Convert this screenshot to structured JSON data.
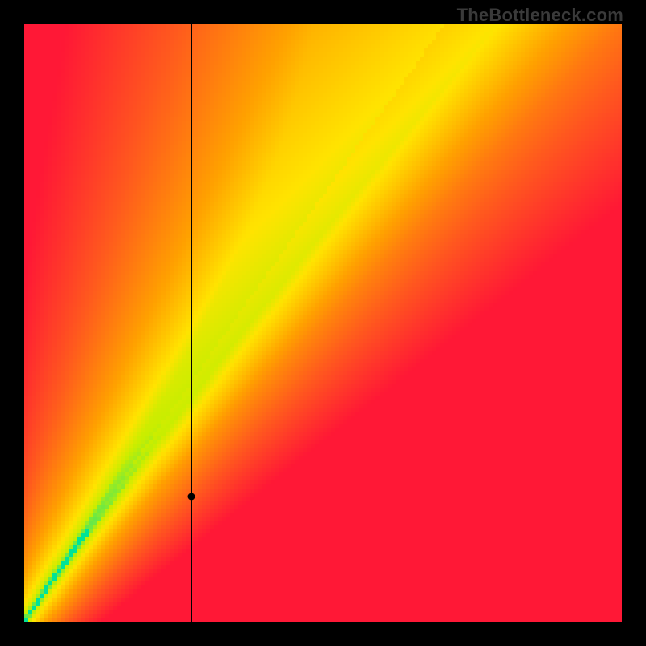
{
  "watermark": "TheBottleneck.com",
  "chart_data": {
    "type": "heatmap",
    "title": "",
    "xlabel": "",
    "ylabel": "",
    "xlim": [
      0,
      100
    ],
    "ylim": [
      0,
      100
    ],
    "grid": false,
    "legend": false,
    "crosshair": {
      "x": 28,
      "y": 21
    },
    "marker": {
      "x": 28,
      "y": 21
    },
    "optimal_band": {
      "description": "Diagonal green band indicating balanced pairing; slope steeper than 1 in lower third, then straightening toward upper-right.",
      "slope_low": 0.78,
      "slope_high": 1.55,
      "band_half_width_fraction": 0.035
    },
    "color_stops": [
      {
        "ratio_distance": 0.0,
        "color": "#00e397"
      },
      {
        "ratio_distance": 0.07,
        "color": "#c8ee00"
      },
      {
        "ratio_distance": 0.18,
        "color": "#ffe400"
      },
      {
        "ratio_distance": 0.4,
        "color": "#ffa200"
      },
      {
        "ratio_distance": 0.7,
        "color": "#ff5a1e"
      },
      {
        "ratio_distance": 1.0,
        "color": "#ff1836"
      }
    ],
    "pixel_resolution": 148
  }
}
